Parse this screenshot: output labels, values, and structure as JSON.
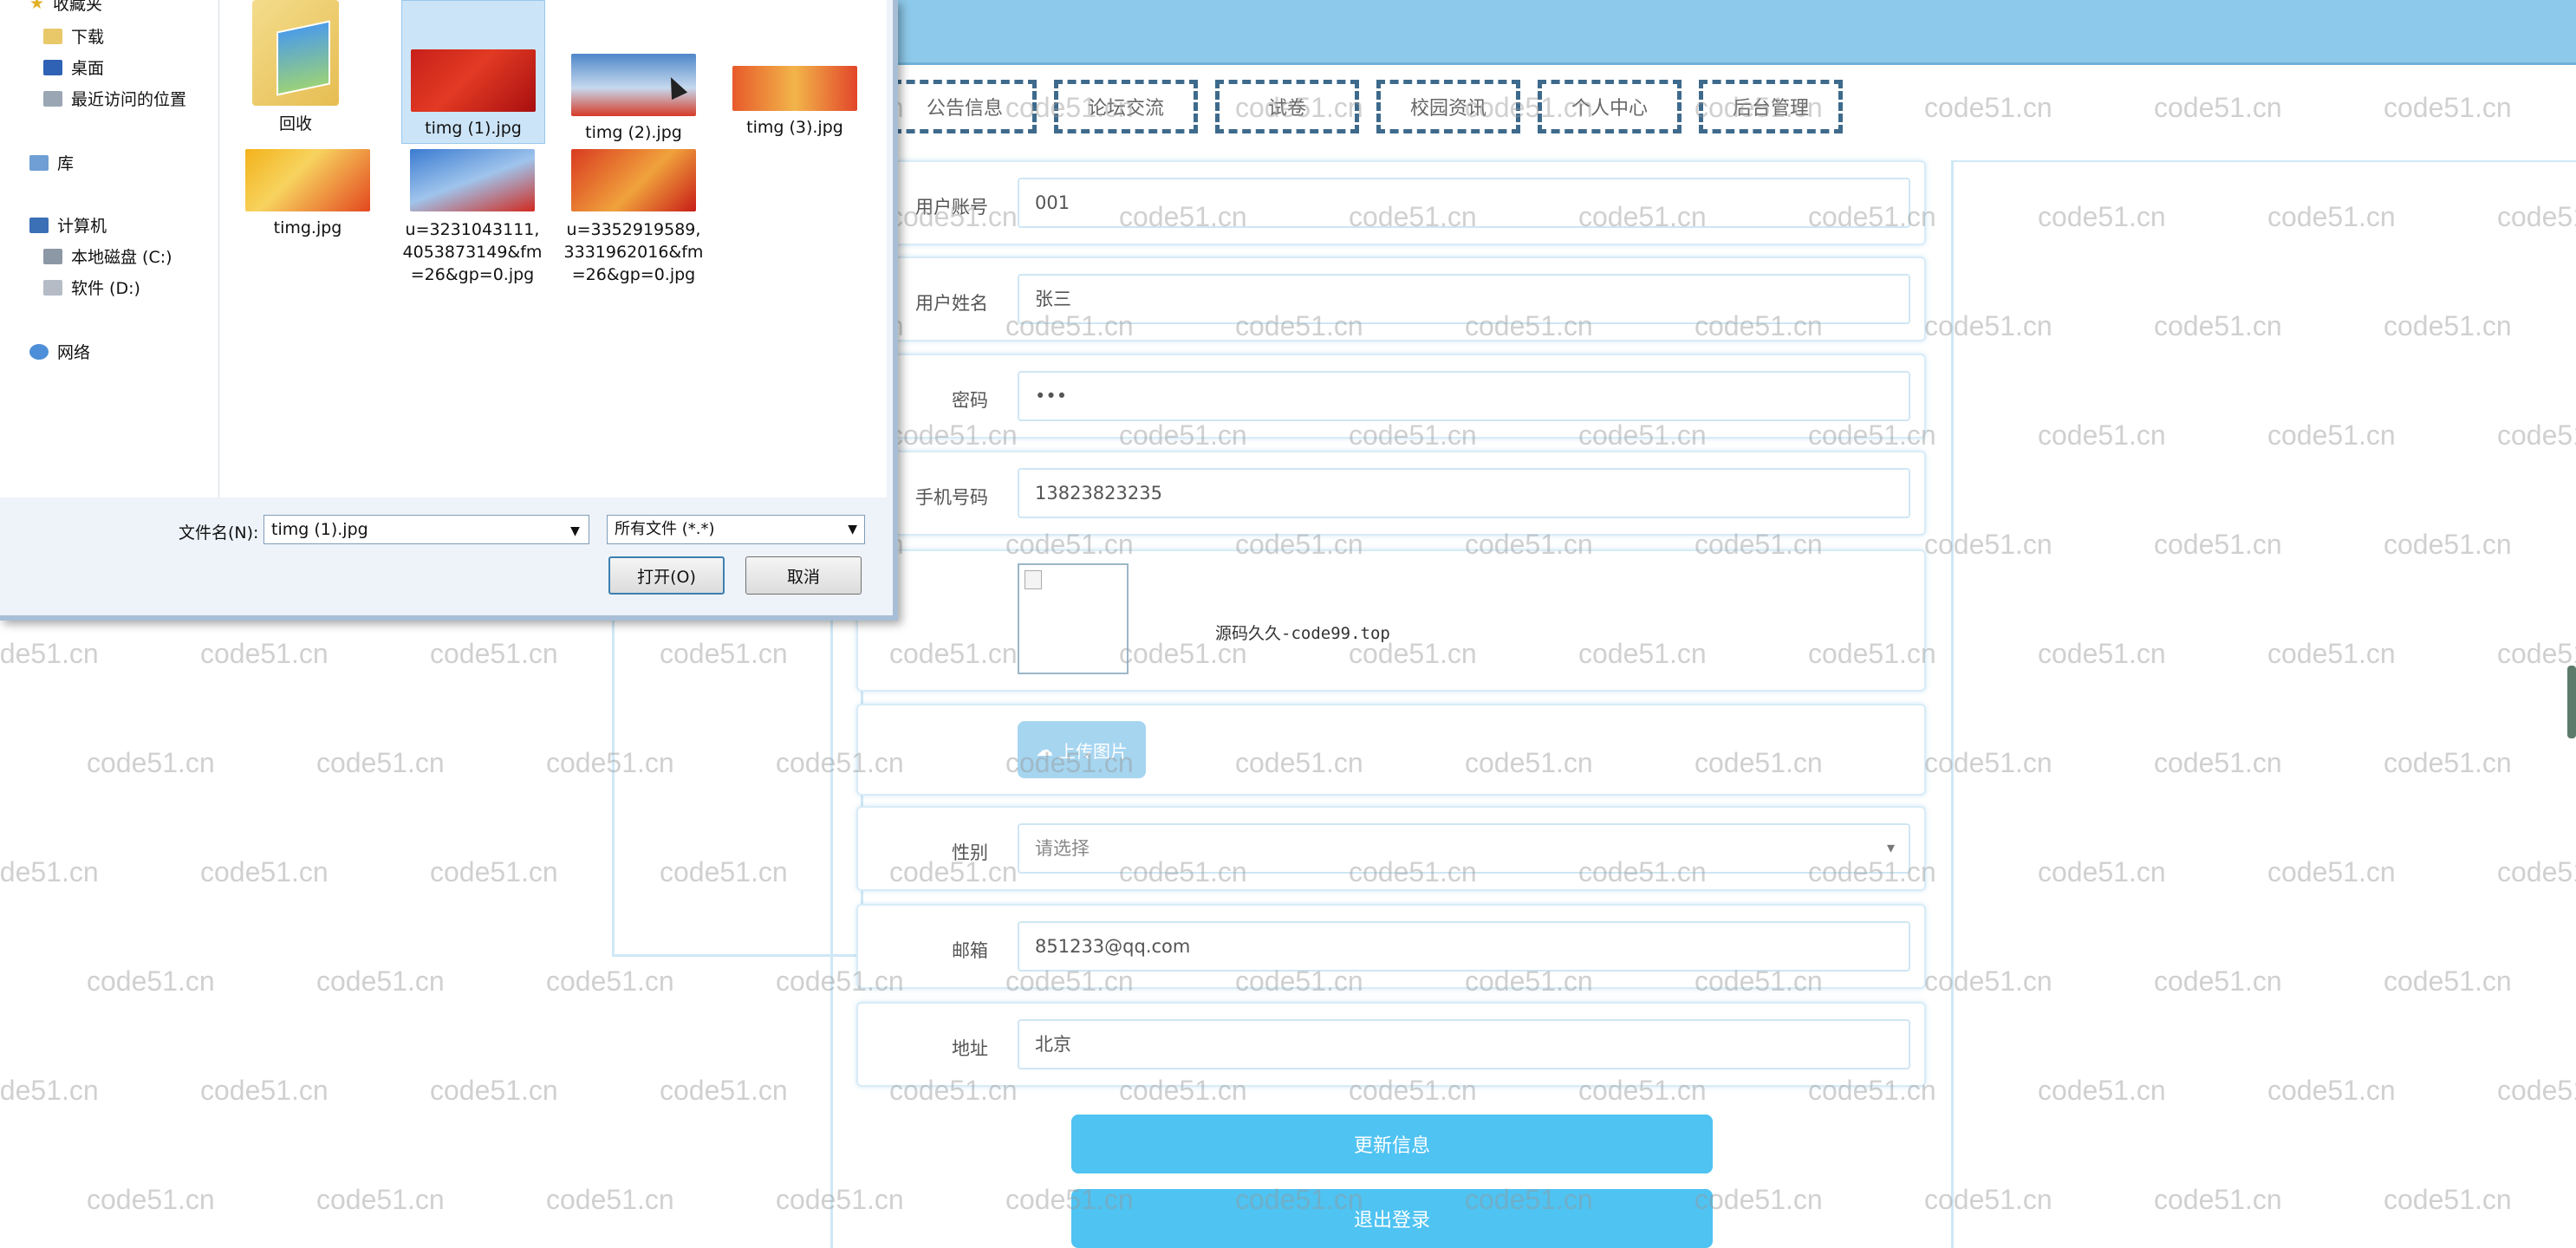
{
  "nav": {
    "items": [
      "公告信息",
      "论坛交流",
      "试卷",
      "校园资讯",
      "个人中心",
      "后台管理"
    ]
  },
  "form": {
    "account": {
      "label": "用户账号",
      "value": "001"
    },
    "name": {
      "label": "用户姓名",
      "value": "张三"
    },
    "password": {
      "label": "密码",
      "value": "•••"
    },
    "phone": {
      "label": "手机号码",
      "value": "13823823235"
    },
    "avatar_alt": "源码久久-code99.top",
    "upload_label": "上传图片",
    "gender": {
      "label": "性别",
      "placeholder": "请选择"
    },
    "email": {
      "label": "邮箱",
      "value": "851233@qq.com"
    },
    "address": {
      "label": "地址",
      "value": "北京"
    },
    "update_button": "更新信息",
    "logout_button": "退出登录"
  },
  "watermark": "code51.cn",
  "dialog": {
    "tree": {
      "favorites": "收藏夹",
      "downloads": "下载",
      "desktop": "桌面",
      "recent": "最近访问的位置",
      "libraries": "库",
      "computer": "计算机",
      "local_disk": "本地磁盘 (C:)",
      "software": "软件 (D:)",
      "network": "网络"
    },
    "files": [
      "回收",
      "timg (1).jpg",
      "timg (2).jpg",
      "timg (3).jpg",
      "timg.jpg",
      "u=3231043111,4053873149&fm=26&gp=0.jpg",
      "u=3352919589,3331962016&fm=26&gp=0.jpg"
    ],
    "filename_label": "文件名(N):",
    "filename_value": "timg (1).jpg",
    "filetype_value": "所有文件 (*.*)",
    "open_button": "打开(O)",
    "cancel_button": "取消"
  },
  "colors": {
    "topbar": "#8dc9ea",
    "nav_border": "#3e6a8c",
    "primary_button": "#4fc3f2",
    "upload_button": "#a6d5f0"
  }
}
